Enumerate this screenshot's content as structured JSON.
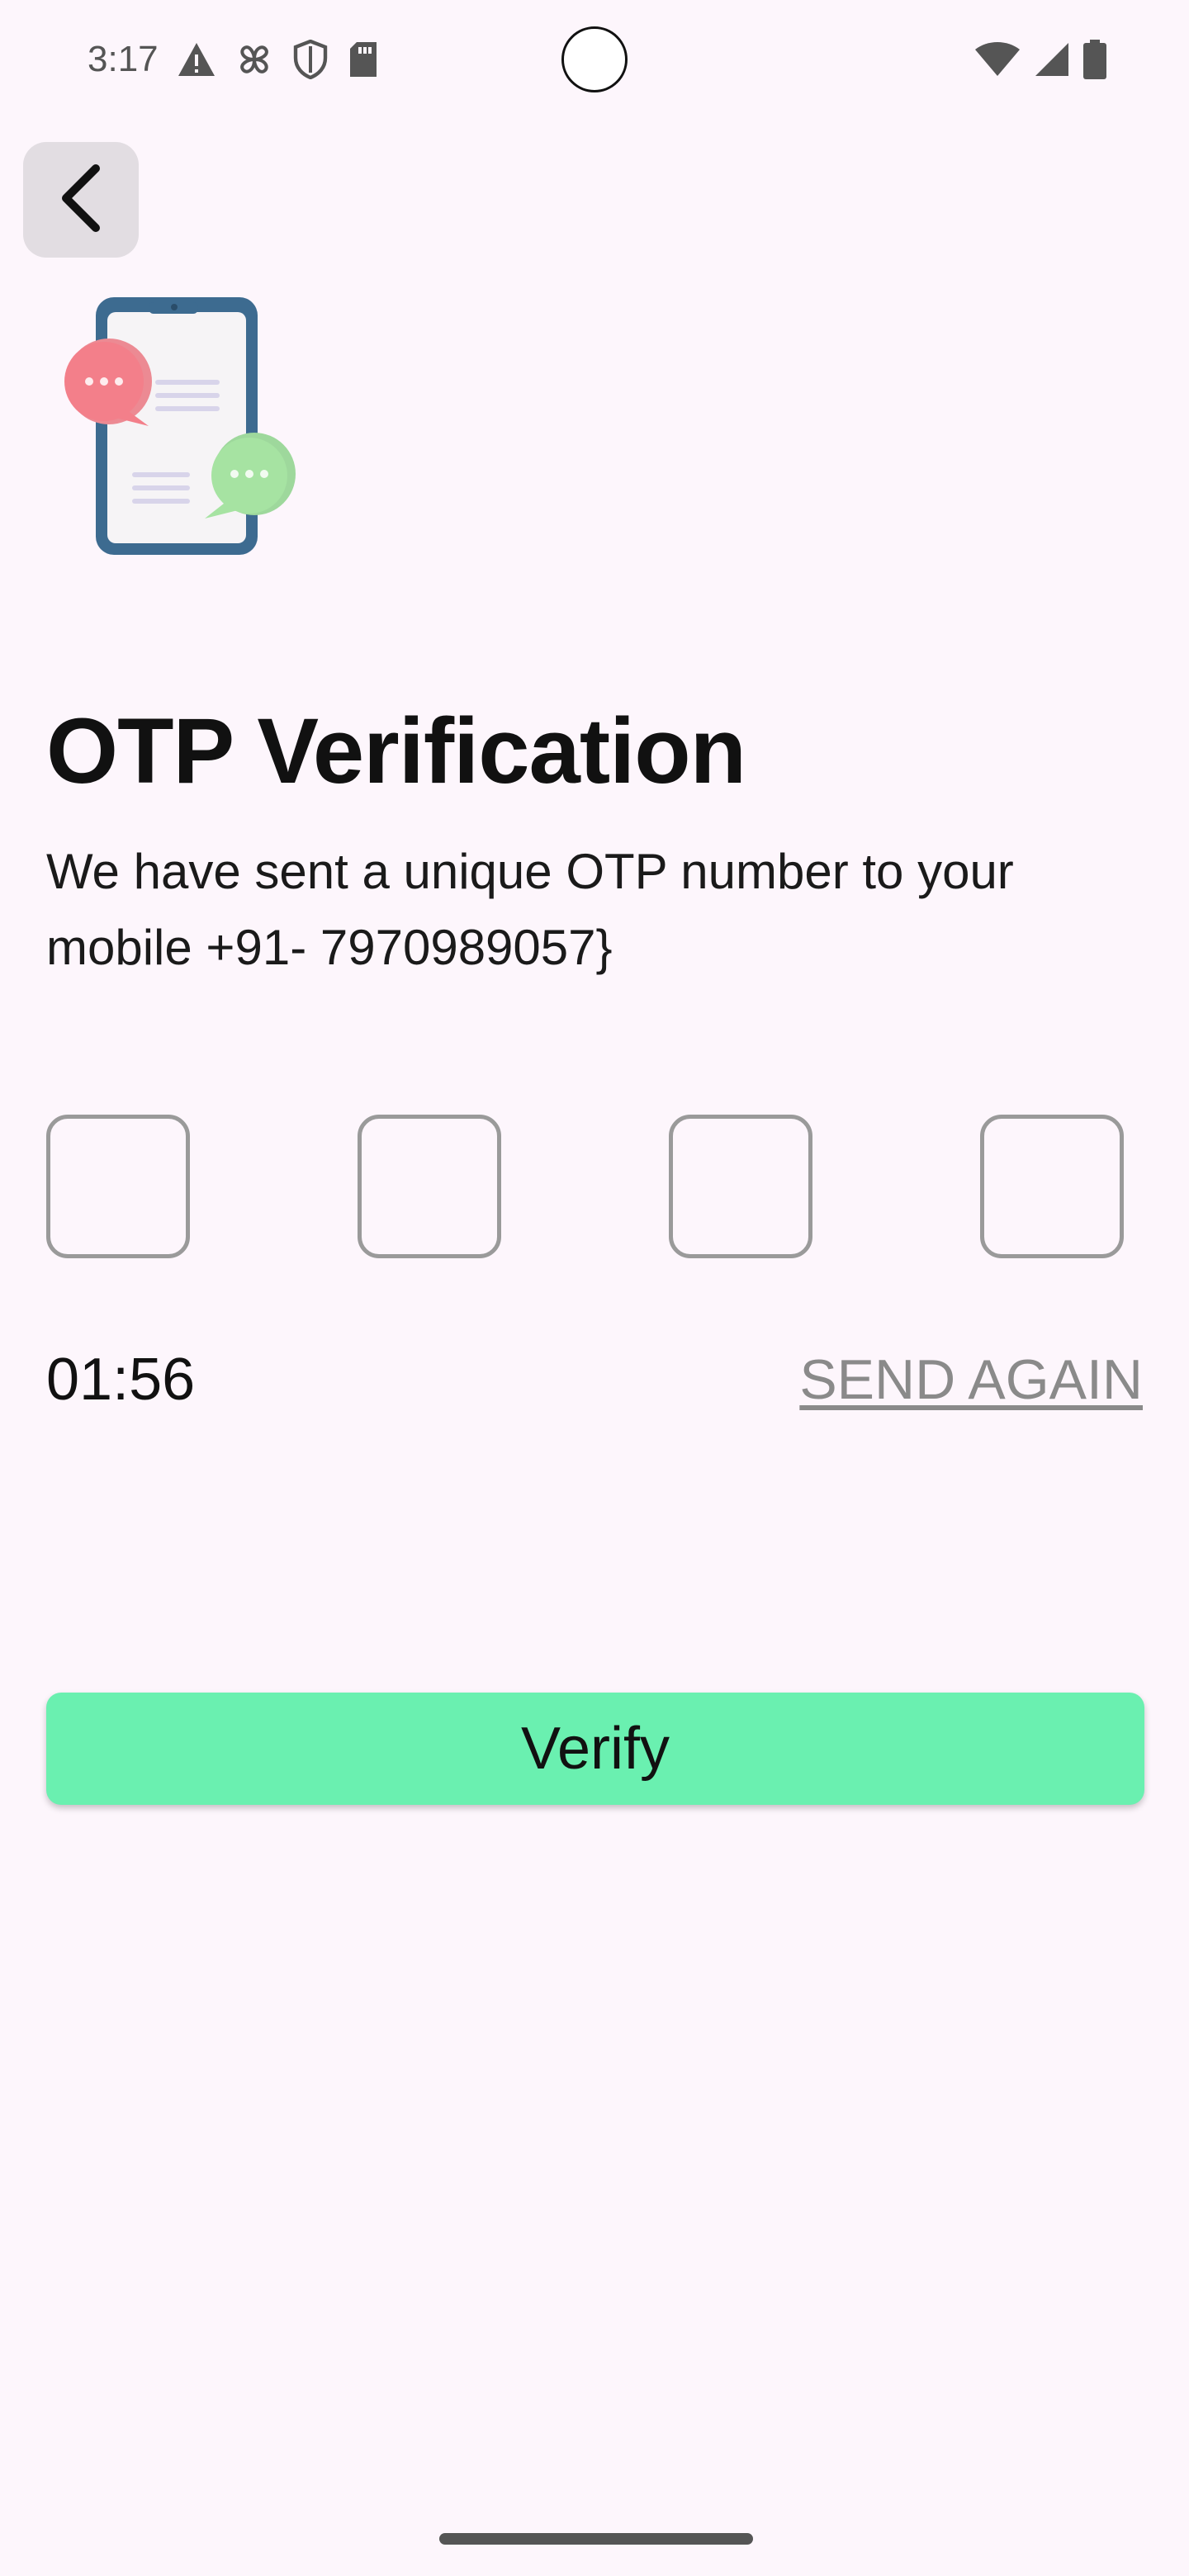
{
  "status_bar": {
    "time": "3:17",
    "left_icons": [
      "alert-icon",
      "fan-icon",
      "shield-icon",
      "sd-card-icon"
    ],
    "right_icons": [
      "wifi-icon",
      "signal-icon",
      "battery-icon"
    ]
  },
  "header": {
    "back_icon": "chevron-left-icon"
  },
  "main": {
    "title": "OTP Verification",
    "subtitle": "We have sent a unique OTP number to your mobile +91- 7970989057}",
    "otp_values": [
      "",
      "",
      "",
      ""
    ],
    "timer": "01:56",
    "send_again_label": "SEND AGAIN",
    "verify_label": "Verify"
  },
  "colors": {
    "background": "#fdf6fc",
    "verify_button": "#6af0b0",
    "otp_border": "#9a9a9a",
    "send_again": "#8a8a8a",
    "back_button_bg": "#e2dde2"
  }
}
